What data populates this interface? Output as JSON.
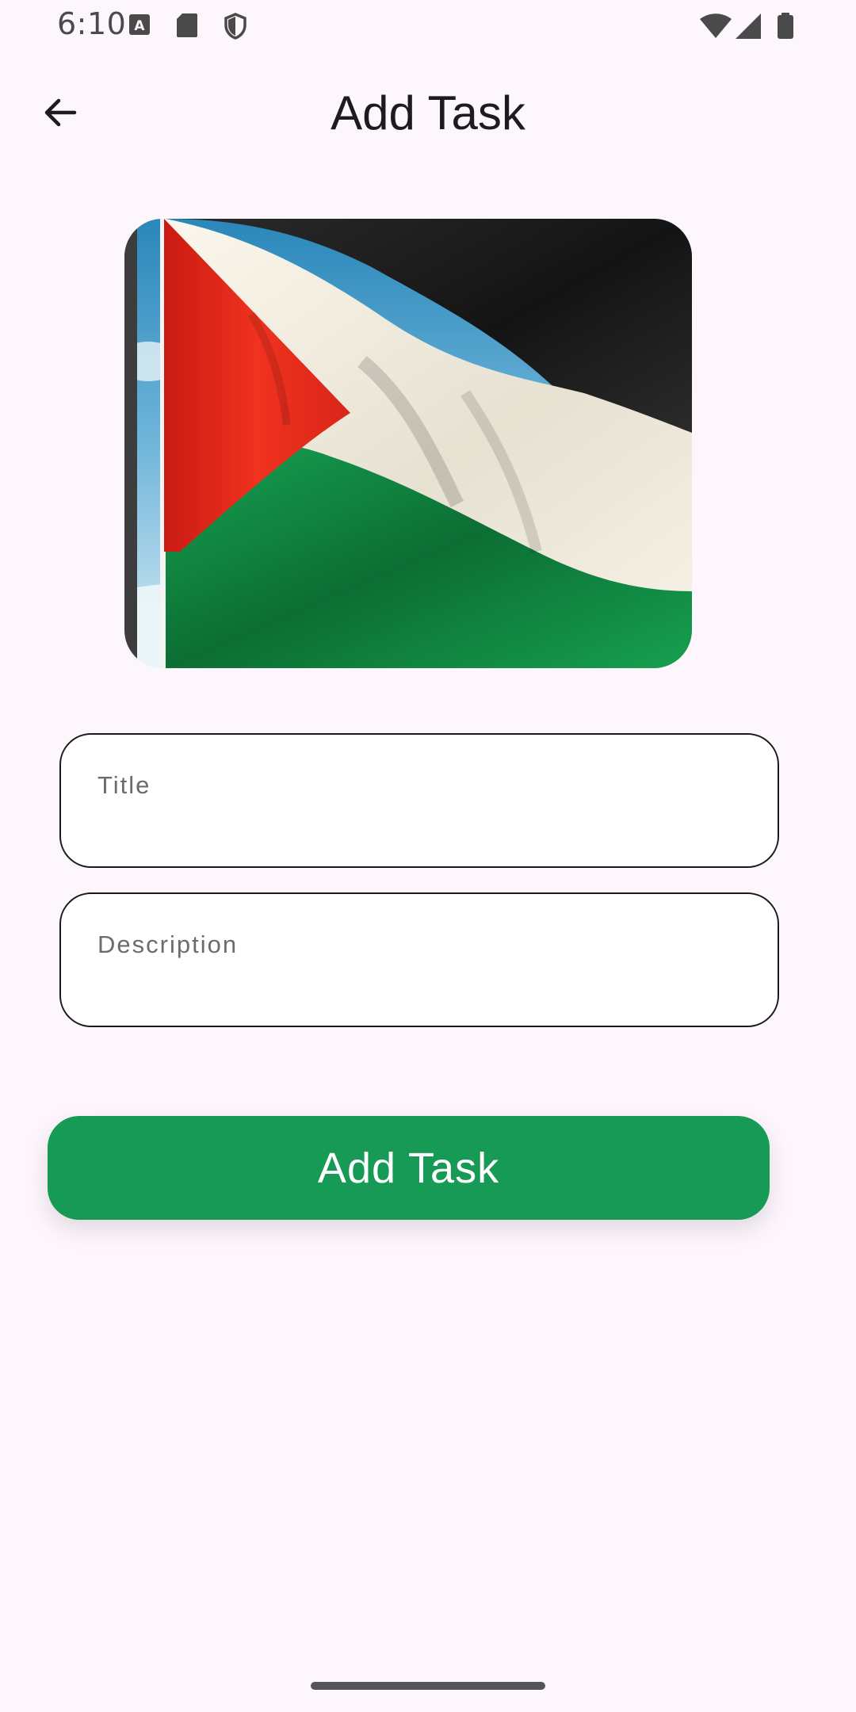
{
  "status_bar": {
    "time": "6:10",
    "icons": [
      "a-box-icon",
      "sd-card-icon",
      "shield-icon",
      "wifi-icon",
      "signal-icon",
      "battery-icon"
    ]
  },
  "app_bar": {
    "title": "Add Task",
    "back_icon": "arrow-left-icon"
  },
  "hero_image": {
    "subject": "flag waving against a blue sky",
    "colors": {
      "red": "#e3261c",
      "black": "#1c1c1c",
      "white": "#f1ece0",
      "green": "#118a43",
      "sky": "#4aa3cf"
    }
  },
  "form": {
    "title_placeholder": "Title",
    "description_placeholder": "Description",
    "title_value": "",
    "description_value": ""
  },
  "submit": {
    "label": "Add Task",
    "color": "#169a55"
  }
}
